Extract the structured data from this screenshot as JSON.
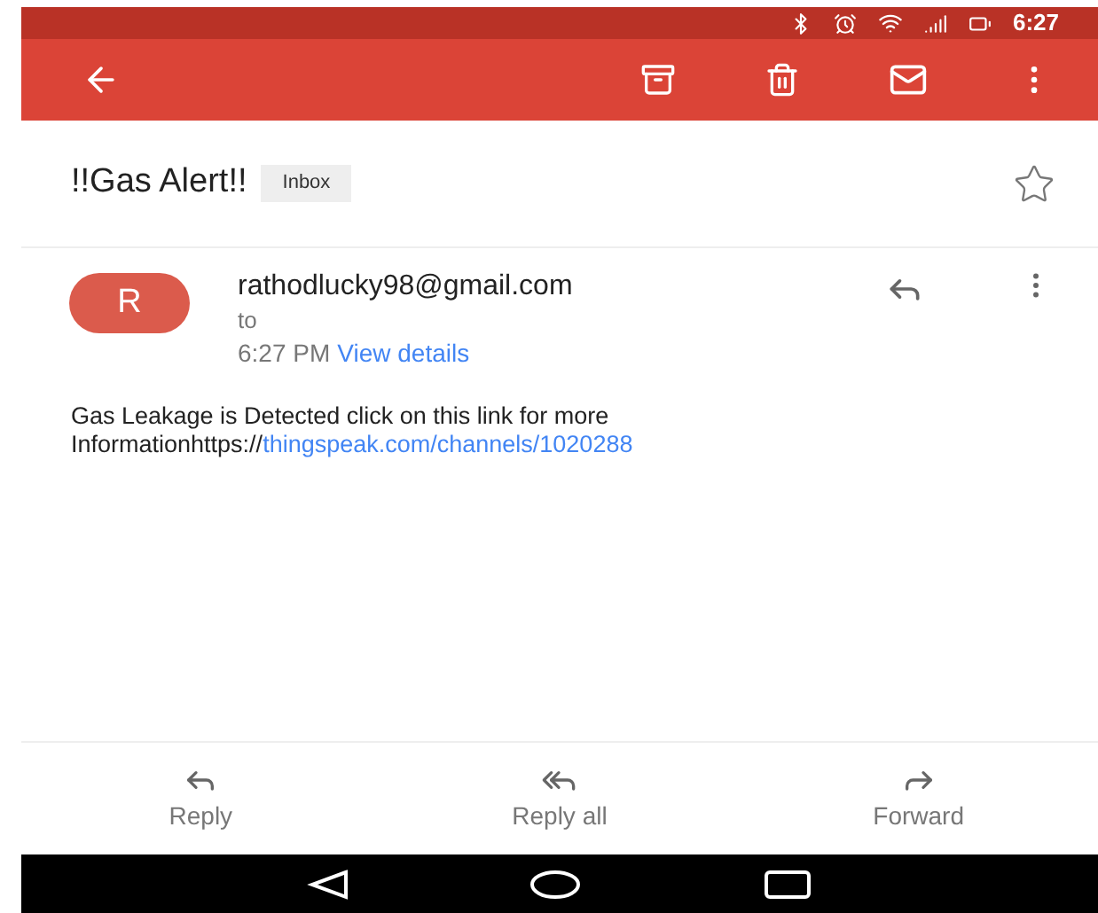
{
  "status_bar": {
    "time": "6:27"
  },
  "email": {
    "subject": "!!Gas Alert!!",
    "label": "Inbox",
    "starred": false,
    "sender": {
      "initial": "R",
      "address": "rathodlucky98@gmail.com",
      "to": "to",
      "time": "6:27 PM",
      "details_link": "View details"
    },
    "body": {
      "text": "Gas Leakage is Detected click on this link for more Informationhttps://",
      "link": "thingspeak.com/channels/1020288"
    }
  },
  "actions": [
    {
      "kind": "reply",
      "label": "Reply"
    },
    {
      "kind": "reply_all",
      "label": "Reply all"
    },
    {
      "kind": "forward",
      "label": "Forward"
    }
  ]
}
